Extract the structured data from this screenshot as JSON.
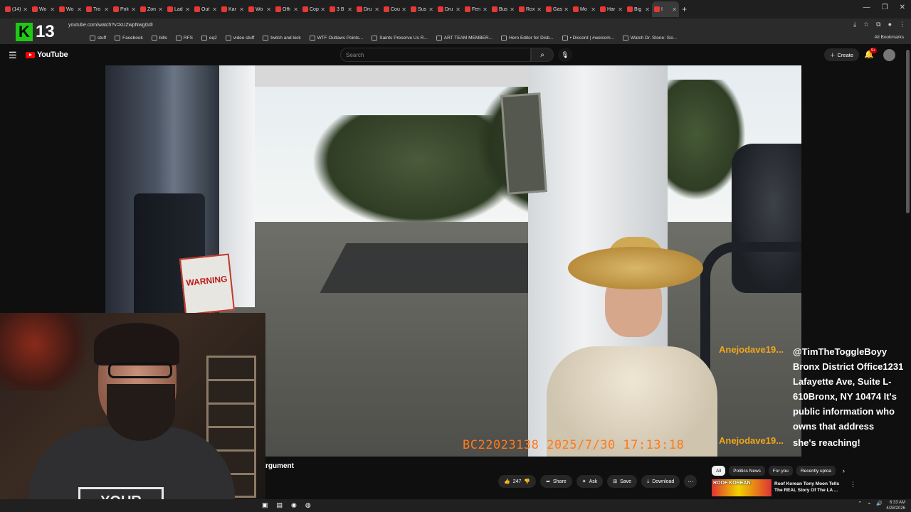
{
  "browser": {
    "tabs": [
      {
        "title": "(14)"
      },
      {
        "title": "Wo"
      },
      {
        "title": "Wo"
      },
      {
        "title": "Tro"
      },
      {
        "title": "Poli"
      },
      {
        "title": "Zon"
      },
      {
        "title": "Lad"
      },
      {
        "title": "Out"
      },
      {
        "title": "Kar"
      },
      {
        "title": "Wo"
      },
      {
        "title": "Offi"
      },
      {
        "title": "Cop"
      },
      {
        "title": "3 B"
      },
      {
        "title": "Dru"
      },
      {
        "title": "Cou"
      },
      {
        "title": "Sus"
      },
      {
        "title": "Dru"
      },
      {
        "title": "Fen"
      },
      {
        "title": "Bus"
      },
      {
        "title": "Rox"
      },
      {
        "title": "Gas"
      },
      {
        "title": "Mo"
      },
      {
        "title": "Har"
      },
      {
        "title": "Big"
      },
      {
        "title": "I"
      }
    ],
    "url": "youtube.com/watch?v=kUZwpNwgGdI",
    "bookmarks": [
      "stuff",
      "Facebook",
      "bills",
      "RFS",
      "eq2",
      "video stuff",
      "twitch and kick",
      "WTF Outlaws Points...",
      "Saints Preserve Us R...",
      "ART TEAM MEMBER...",
      "Hero Editor for Disb...",
      "• Discord | #welcom...",
      "Watch Dr. Stone: Sci..."
    ],
    "all_bookmarks": "All Bookmarks"
  },
  "overlay": {
    "k_logo": "K",
    "viewer_count": "13"
  },
  "youtube": {
    "logo_text": "YouTube",
    "search_placeholder": "Search",
    "create_label": "Create",
    "notif_badge": "9+"
  },
  "video": {
    "timestamp_stamp": "BC22023138   2025/7/30   17:13:18",
    "warning_sign": "WARNING",
    "title_fragment": "rgument"
  },
  "webcam": {
    "shirt_text": "YOUR"
  },
  "chat": [
    {
      "user": "Anejodave19...",
      "message": "@TimTheToggleBoyy Bronx District Office1231 Lafayette Ave, Suite L-610Bronx, NY 10474 It's public information who owns that address"
    },
    {
      "user": "Anejodave19...",
      "message": "she's reaching!"
    }
  ],
  "actions": {
    "like_count": "247",
    "share": "Share",
    "ask": "Ask",
    "save": "Save",
    "download": "Download"
  },
  "chips": [
    "All",
    "Politics News",
    "For you",
    "Recently uploa"
  ],
  "recommendation": {
    "thumb_text": "ROOF KOREAN",
    "title": "Roof Korean Tony Moon Tells The REAL Story Of The LA ..."
  },
  "taskbar": {
    "time": "6:33 AM",
    "date": "4/28/2026"
  },
  "colors": {
    "yt_red": "#ff0000",
    "chat_name": "#f0a71c",
    "stamp": "#ff7a1a",
    "k_green": "#1ec814"
  }
}
